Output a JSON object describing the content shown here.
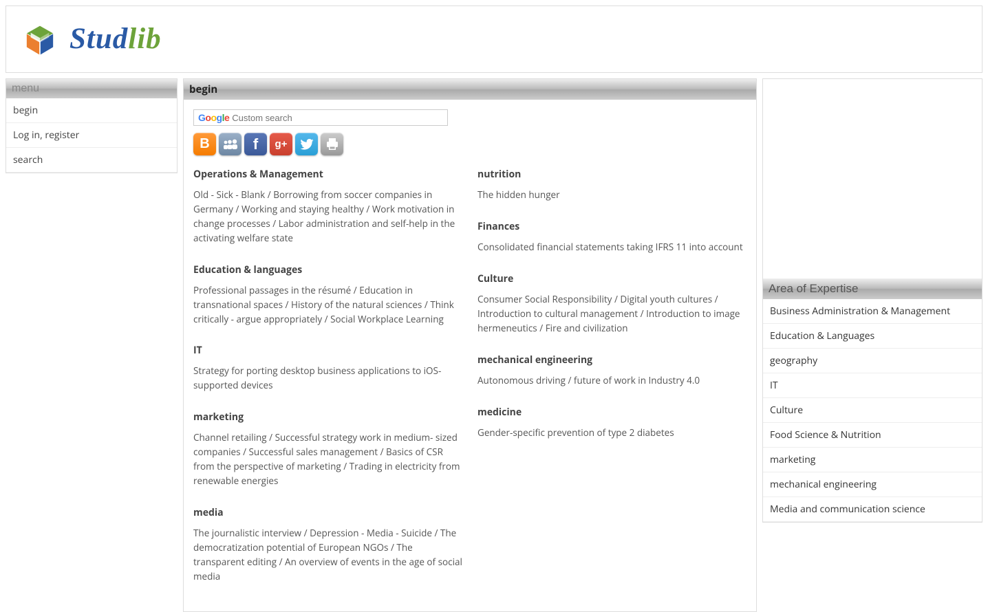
{
  "logo": {
    "stud": "Stud",
    "lib": "lib"
  },
  "sidebar": {
    "title": "menu",
    "items": [
      "begin",
      "Log in, register",
      "search"
    ]
  },
  "main": {
    "title": "begin",
    "search_placeholder": "Custom search",
    "left_sections": [
      {
        "heading": "Operations & Management",
        "items": [
          "Old - Sick - Blank",
          "Borrowing from soccer companies in Germany",
          "Working and staying healthy",
          "Work motivation in change processes",
          "Labor administration and self-help in the activating welfare state"
        ]
      },
      {
        "heading": "Education & languages",
        "items": [
          "Professional passages in the résumé",
          "Education in transnational spaces",
          "History of the natural sciences",
          "Think critically - argue appropriately",
          "Social Workplace Learning"
        ]
      },
      {
        "heading": "IT",
        "items": [
          "Strategy for porting desktop business applications to iOS-supported devices"
        ]
      },
      {
        "heading": "marketing",
        "items": [
          "Channel retailing",
          "Successful strategy work in medium- sized companies",
          "Successful sales management",
          "Basics of CSR from the perspective of marketing",
          "Trading in electricity from renewable energies"
        ]
      },
      {
        "heading": "media",
        "items": [
          "The journalistic interview",
          "Depression - Media - Suicide",
          "The democratization potential of European NGOs",
          "The transparent editing",
          "An overview of events in the age of social media"
        ]
      }
    ],
    "right_sections": [
      {
        "heading": "nutrition",
        "items": [
          "The hidden hunger"
        ]
      },
      {
        "heading": "Finances",
        "items": [
          "Consolidated financial statements taking IFRS 11 into account"
        ]
      },
      {
        "heading": "Culture",
        "items": [
          "Consumer Social Responsibility",
          "Digital youth cultures",
          "Introduction to cultural management",
          "Introduction to image hermeneutics",
          "Fire and civilization"
        ]
      },
      {
        "heading": "mechanical engineering",
        "items": [
          "Autonomous driving",
          "future of work in Industry 4.0"
        ]
      },
      {
        "heading": "medicine",
        "items": [
          "Gender-specific prevention of type 2 diabetes"
        ]
      }
    ]
  },
  "expertise": {
    "title": "Area of Expertise",
    "items": [
      "Business Administration & Management",
      "Education & Languages",
      "geography",
      "IT",
      "Culture",
      "Food Science & Nutrition",
      "marketing",
      "mechanical engineering",
      "Media and communication science"
    ]
  }
}
